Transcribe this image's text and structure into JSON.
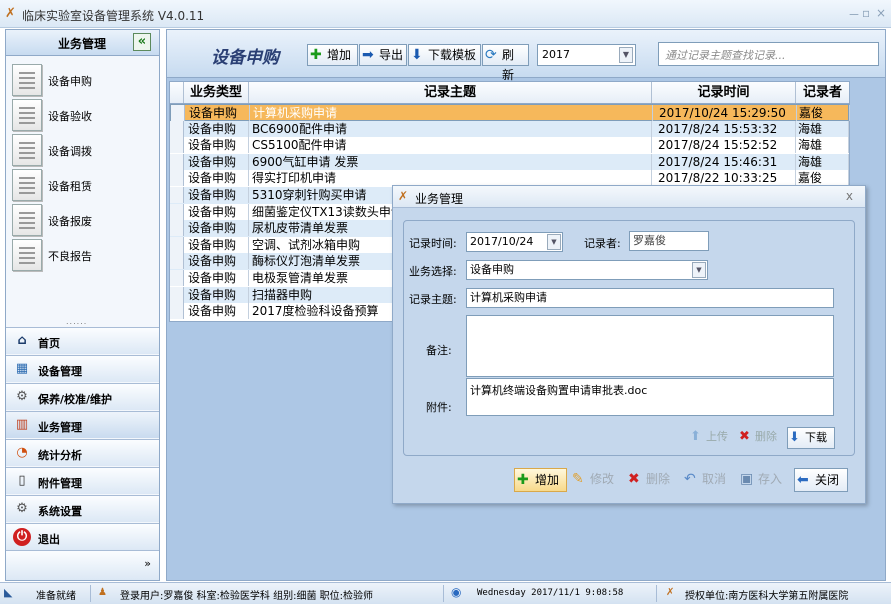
{
  "window": {
    "title": "临床实验室设备管理系统 V4.0.11",
    "min": "－",
    "max": "▫",
    "close": "×"
  },
  "sidebar": {
    "header": "业务管理",
    "collapse_icon": "«",
    "items": [
      {
        "label": "设备申购"
      },
      {
        "label": "设备验收"
      },
      {
        "label": "设备调拨"
      },
      {
        "label": "设备租赁"
      },
      {
        "label": "设备报废"
      },
      {
        "label": "不良报告"
      }
    ],
    "dots": "......",
    "nav": [
      {
        "label": "首页",
        "icon": "⌂"
      },
      {
        "label": "设备管理",
        "icon": "▦"
      },
      {
        "label": "保养/校准/维护",
        "icon": "⚙"
      },
      {
        "label": "业务管理",
        "icon": "▥"
      },
      {
        "label": "统计分析",
        "icon": "◔"
      },
      {
        "label": "附件管理",
        "icon": "▯"
      },
      {
        "label": "系统设置",
        "icon": "⚙"
      },
      {
        "label": "退出",
        "icon": "⏻"
      }
    ],
    "more": "»"
  },
  "toolbar": {
    "title": "设备申购",
    "add": "增加",
    "export": "导出",
    "download_template": "下载模板",
    "refresh": "刷新",
    "year": "2017",
    "search_placeholder": "通过记录主题查找记录..."
  },
  "table": {
    "columns": [
      "业务类型",
      "记录主题",
      "记录时间",
      "记录者"
    ],
    "rows": [
      {
        "type": "设备申购",
        "subject": "计算机采购申请",
        "time": "2017/10/24 15:29:50",
        "user": "嘉俊"
      },
      {
        "type": "设备申购",
        "subject": "BC6900配件申请",
        "time": "2017/8/24 15:53:32",
        "user": "海雄"
      },
      {
        "type": "设备申购",
        "subject": "CS5100配件申请",
        "time": "2017/8/24 15:52:52",
        "user": "海雄"
      },
      {
        "type": "设备申购",
        "subject": "6900气缸申请 发票",
        "time": "2017/8/24 15:46:31",
        "user": "海雄"
      },
      {
        "type": "设备申购",
        "subject": "得实打印机申请",
        "time": "2017/8/22 10:33:25",
        "user": "嘉俊"
      },
      {
        "type": "设备申购",
        "subject": "5310穿刺针购买申请",
        "time": "",
        "user": ""
      },
      {
        "type": "设备申购",
        "subject": "细菌鉴定仪TX13读数头申请",
        "time": "",
        "user": ""
      },
      {
        "type": "设备申购",
        "subject": "尿机皮带清单发票",
        "time": "",
        "user": ""
      },
      {
        "type": "设备申购",
        "subject": "空调、试剂冰箱申购",
        "time": "",
        "user": ""
      },
      {
        "type": "设备申购",
        "subject": "酶标仪灯泡清单发票",
        "time": "",
        "user": ""
      },
      {
        "type": "设备申购",
        "subject": "电极泵管清单发票",
        "time": "",
        "user": ""
      },
      {
        "type": "设备申购",
        "subject": "扫描器申购",
        "time": "",
        "user": ""
      },
      {
        "type": "设备申购",
        "subject": "2017度检验科设备预算",
        "time": "",
        "user": ""
      }
    ]
  },
  "dialog": {
    "title": "业务管理",
    "close": "x",
    "record_time_label": "记录时间:",
    "record_time": "2017/10/24",
    "recorder_label": "记录者:",
    "recorder": "罗嘉俊",
    "business_label": "业务选择:",
    "business": "设备申购",
    "subject_label": "记录主题:",
    "subject": "计算机采购申请",
    "remark_label": "备注:",
    "remark": "",
    "attachment_label": "附件:",
    "attachment": "计算机终端设备购置申请审批表.doc",
    "upload": "上传",
    "delete_att": "删除",
    "download": "下载",
    "add": "增加",
    "edit": "修改",
    "delete": "删除",
    "cancel": "取消",
    "save": "存入",
    "close_btn": "关闭"
  },
  "status": {
    "ready": "准备就绪",
    "user_info": "登录用户:罗嘉俊  科室:检验医学科  组别:细菌  职位:检验师",
    "datetime": "Wednesday 2017/11/1 9:08:58",
    "org": "授权单位:南方医科大学第五附属医院"
  }
}
